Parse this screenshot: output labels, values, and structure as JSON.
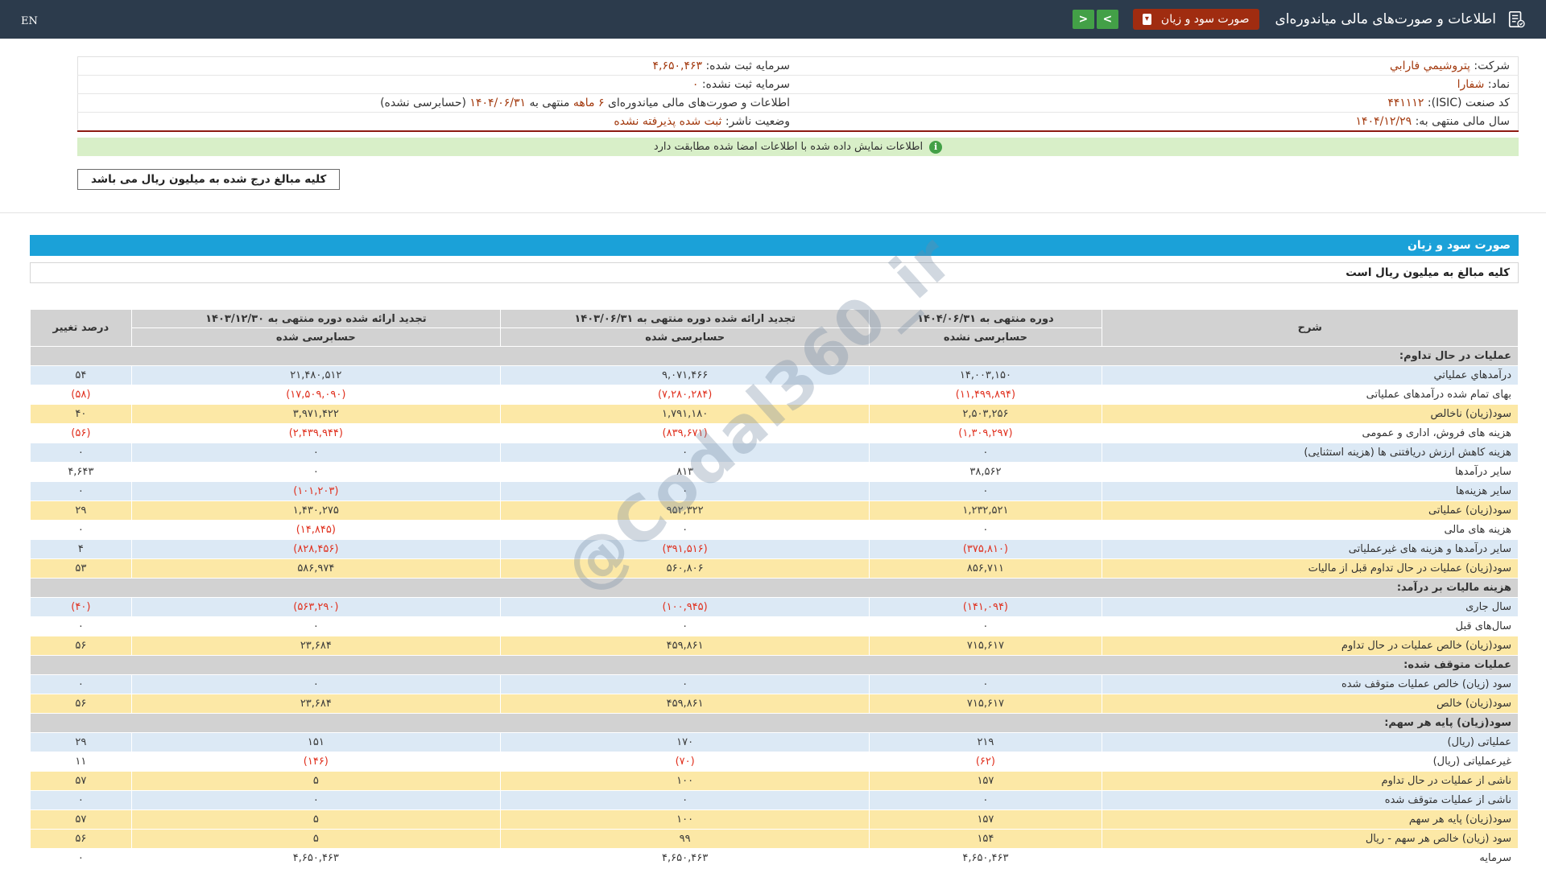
{
  "colors": {
    "topbar_bg": "#2c3b4c",
    "dropdown_bg": "#a02c10",
    "nav_button_green": "#43a047",
    "banner_green_bg": "#d8efc8",
    "statement_bar_blue": "#1ba1d8",
    "row_blue": "#dce9f5",
    "row_yellow": "#fce8a6",
    "section_gray": "#d2d2d2",
    "negative_red": "#e0301e",
    "info_value_red": "#a33a0f",
    "header_underline_red": "#8e1b12"
  },
  "topbar": {
    "title": "اطلاعات و صورت‌های مالی میاندوره‌ای",
    "dropdown_label": "صورت سود و زیان",
    "dropdown_caret": "▾",
    "nav_next": ">",
    "nav_prev": "<",
    "en_label": "EN"
  },
  "info": {
    "rows": [
      {
        "right_label": "شرکت:",
        "right_value": "پتروشيمي فارابي",
        "left_label": "سرمایه ثبت شده:",
        "left_value": "۴,۶۵۰,۴۶۳"
      },
      {
        "right_label": "نماد:",
        "right_value": "شفارا",
        "left_label": "سرمایه ثبت نشده:",
        "left_value": "۰"
      },
      {
        "right_label": "کد صنعت (ISIC):",
        "right_value": "۴۴۱۱۱۲",
        "left_label": "اطلاعات و صورت‌های مالی میاندوره‌ای",
        "left_parts": [
          {
            "t": "۶ ماهه",
            "red": true
          },
          {
            "t": "منتهی به",
            "red": false
          },
          {
            "t": "۱۴۰۴/۰۶/۳۱",
            "red": true
          },
          {
            "t": "(حسابرسی نشده)",
            "red": false
          }
        ]
      },
      {
        "right_label": "سال مالی منتهی به:",
        "right_value": "۱۴۰۴/۱۲/۲۹",
        "left_label": "وضعیت ناشر:",
        "left_value": "ثبت شده پذیرفته نشده"
      }
    ],
    "info_icon": "i",
    "signed_banner": "اطلاعات نمایش داده شده با اطلاعات امضا شده مطابقت دارد",
    "million_note": "کلیه مبالغ درج شده به میلیون ریال می باشد"
  },
  "watermark": {
    "text": "@Codal360_ir"
  },
  "statement": {
    "title": "صورت سود و زیان",
    "unit_note": "کلیه مبالغ به میلیون ریال است",
    "columns": {
      "desc": "شرح",
      "p1": {
        "title": "دوره منتهی به ۱۴۰۴/۰۶/۳۱",
        "sub": "حسابرسی نشده"
      },
      "p2": {
        "title": "تجدید ارائه شده دوره منتهی به ۱۴۰۳/۰۶/۳۱",
        "sub": "حسابرسی شده"
      },
      "p3": {
        "title": "تجدید ارائه شده دوره منتهی به ۱۴۰۳/۱۲/۳۰",
        "sub": "حسابرسی شده"
      },
      "pct": "درصد تغییر"
    },
    "rows": [
      {
        "type": "section",
        "label": "عملیات در حال تداوم:"
      },
      {
        "type": "data",
        "cls": "blue",
        "label": "درآمدهاي عملياتي",
        "v1": "۱۴,۰۰۳,۱۵۰",
        "v2": "۹,۰۷۱,۴۶۶",
        "v3": "۲۱,۴۸۰,۵۱۲",
        "pct": "۵۴"
      },
      {
        "type": "data",
        "cls": "white",
        "label": "بهای تمام شده درآمدهای عملیاتی",
        "v1": "(۱۱,۴۹۹,۸۹۴)",
        "v2": "(۷,۲۸۰,۲۸۴)",
        "v3": "(۱۷,۵۰۹,۰۹۰)",
        "pct": "(۵۸)"
      },
      {
        "type": "data",
        "cls": "yellow",
        "label": "سود(زیان) ناخالص",
        "v1": "۲,۵۰۳,۲۵۶",
        "v2": "۱,۷۹۱,۱۸۰",
        "v3": "۳,۹۷۱,۴۲۲",
        "pct": "۴۰"
      },
      {
        "type": "data",
        "cls": "white",
        "label": "هزینه های فروش، اداری و عمومی",
        "v1": "(۱,۳۰۹,۲۹۷)",
        "v2": "(۸۳۹,۶۷۱)",
        "v3": "(۲,۴۳۹,۹۴۴)",
        "pct": "(۵۶)"
      },
      {
        "type": "data",
        "cls": "blue",
        "label": "هزینه کاهش ارزش دریافتنی ها (هزینه استثنایی)",
        "v1": "۰",
        "v2": "۰",
        "v3": "۰",
        "pct": "۰"
      },
      {
        "type": "data",
        "cls": "white",
        "label": "سایر درآمدها",
        "v1": "۳۸,۵۶۲",
        "v2": "۸۱۳",
        "v3": "۰",
        "pct": "۴,۶۴۳"
      },
      {
        "type": "data",
        "cls": "blue",
        "label": "سایر هزینه‌ها",
        "v1": "۰",
        "v2": "۰",
        "v3": "(۱۰۱,۲۰۳)",
        "pct": "۰"
      },
      {
        "type": "data",
        "cls": "yellow",
        "label": "سود(زیان) عملیاتی",
        "v1": "۱,۲۳۲,۵۲۱",
        "v2": "۹۵۲,۳۲۲",
        "v3": "۱,۴۳۰,۲۷۵",
        "pct": "۲۹"
      },
      {
        "type": "data",
        "cls": "white",
        "label": "هزینه های مالی",
        "v1": "۰",
        "v2": "۰",
        "v3": "(۱۴,۸۴۵)",
        "pct": "۰"
      },
      {
        "type": "data",
        "cls": "blue",
        "label": "سایر درآمدها و هزینه های غیرعملیاتی",
        "v1": "(۳۷۵,۸۱۰)",
        "v2": "(۳۹۱,۵۱۶)",
        "v3": "(۸۲۸,۴۵۶)",
        "pct": "۴"
      },
      {
        "type": "data",
        "cls": "yellow",
        "label": "سود(زیان) عملیات در حال تداوم قبل از مالیات",
        "v1": "۸۵۶,۷۱۱",
        "v2": "۵۶۰,۸۰۶",
        "v3": "۵۸۶,۹۷۴",
        "pct": "۵۳"
      },
      {
        "type": "section",
        "label": "هزینه مالیات بر درآمد:"
      },
      {
        "type": "data",
        "cls": "blue",
        "label": "سال جاری",
        "v1": "(۱۴۱,۰۹۴)",
        "v2": "(۱۰۰,۹۴۵)",
        "v3": "(۵۶۳,۲۹۰)",
        "pct": "(۴۰)"
      },
      {
        "type": "data",
        "cls": "white",
        "label": "سال‌های قبل",
        "v1": "۰",
        "v2": "۰",
        "v3": "۰",
        "pct": "۰"
      },
      {
        "type": "data",
        "cls": "yellow",
        "label": "سود(زیان) خالص عملیات در حال تداوم",
        "v1": "۷۱۵,۶۱۷",
        "v2": "۴۵۹,۸۶۱",
        "v3": "۲۳,۶۸۴",
        "pct": "۵۶"
      },
      {
        "type": "section",
        "label": "عملیات متوقف شده:"
      },
      {
        "type": "data",
        "cls": "blue",
        "label": "سود (زیان) خالص عملیات متوقف شده",
        "v1": "۰",
        "v2": "۰",
        "v3": "۰",
        "pct": "۰"
      },
      {
        "type": "data",
        "cls": "yellow",
        "label": "سود(زیان) خالص",
        "v1": "۷۱۵,۶۱۷",
        "v2": "۴۵۹,۸۶۱",
        "v3": "۲۳,۶۸۴",
        "pct": "۵۶"
      },
      {
        "type": "section",
        "label": "سود(زیان) پایه هر سهم:"
      },
      {
        "type": "data",
        "cls": "blue",
        "label": "عملیاتی (ریال)",
        "v1": "۲۱۹",
        "v2": "۱۷۰",
        "v3": "۱۵۱",
        "pct": "۲۹"
      },
      {
        "type": "data",
        "cls": "white",
        "label": "غیرعملیاتی (ریال)",
        "v1": "(۶۲)",
        "v2": "(۷۰)",
        "v3": "(۱۴۶)",
        "pct": "۱۱"
      },
      {
        "type": "data",
        "cls": "yellow",
        "label": "ناشی از عملیات در حال تداوم",
        "v1": "۱۵۷",
        "v2": "۱۰۰",
        "v3": "۵",
        "pct": "۵۷"
      },
      {
        "type": "data",
        "cls": "blue",
        "label": "ناشی از عملیات متوقف شده",
        "v1": "۰",
        "v2": "۰",
        "v3": "۰",
        "pct": "۰"
      },
      {
        "type": "data",
        "cls": "yellow",
        "label": "سود(زیان) پایه هر سهم",
        "v1": "۱۵۷",
        "v2": "۱۰۰",
        "v3": "۵",
        "pct": "۵۷"
      },
      {
        "type": "data",
        "cls": "yellow",
        "label": "سود (زیان) خالص هر سهم - ریال",
        "v1": "۱۵۴",
        "v2": "۹۹",
        "v3": "۵",
        "pct": "۵۶"
      },
      {
        "type": "data",
        "cls": "white",
        "label": "سرمایه",
        "v1": "۴,۶۵۰,۴۶۳",
        "v2": "۴,۶۵۰,۴۶۳",
        "v3": "۴,۶۵۰,۴۶۳",
        "pct": "۰"
      }
    ]
  }
}
